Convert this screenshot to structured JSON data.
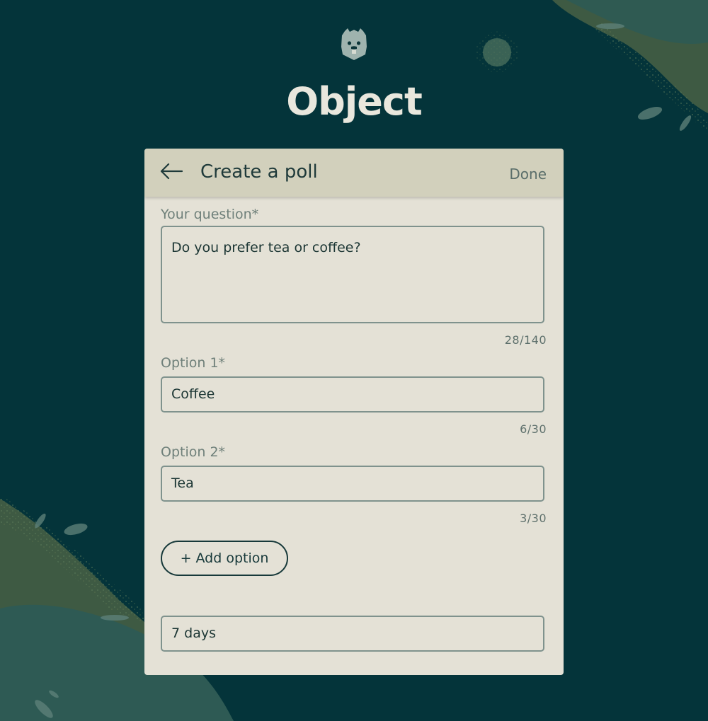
{
  "app": {
    "title": "Object"
  },
  "poll": {
    "header_title": "Create a poll",
    "done_label": "Done",
    "question": {
      "label": "Your question*",
      "value": "Do you prefer tea or coffee?",
      "counter": "28/140"
    },
    "options": [
      {
        "label": "Option 1*",
        "value": "Coffee",
        "counter": "6/30"
      },
      {
        "label": "Option 2*",
        "value": "Tea",
        "counter": "3/30"
      }
    ],
    "add_option_label": "+ Add option",
    "duration": {
      "value": "7 days"
    }
  },
  "icons": {
    "logo": "beaver-logo-icon",
    "back": "arrow-left-icon"
  },
  "colors": {
    "background": "#04343a",
    "card": "#e4e1d6",
    "header": "#d2d0bc",
    "text_dark": "#1c3634",
    "muted": "#6f807a"
  }
}
